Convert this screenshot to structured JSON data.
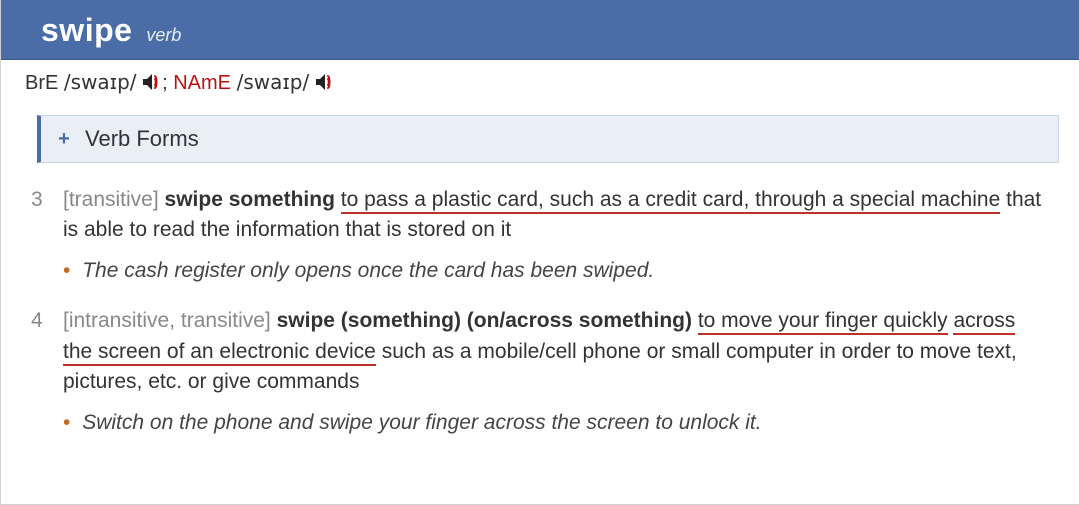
{
  "header": {
    "word": "swipe",
    "pos": "verb"
  },
  "pron": {
    "bre_label": "BrE",
    "bre_ipa": "/swaɪp/",
    "separator": "; ",
    "name_label": "NAmE",
    "name_ipa": "/swaɪp/"
  },
  "verbforms": {
    "plus": "+",
    "label": "Verb Forms"
  },
  "senses": [
    {
      "num": "3",
      "grammar": "[transitive]",
      "bold": "swipe something",
      "def_u1": "to pass a plastic card, such as a credit card, through a special machine",
      "def_rest": " that is able to read the information that is stored on it",
      "example": "The cash register only opens once the card has been swiped."
    },
    {
      "num": "4",
      "grammar": "[intransitive, transitive]",
      "bold": "swipe (something) (on/across something)",
      "def_u1": "to move your finger quickly",
      "def_u2": "across the screen of an electronic device",
      "def_rest": " such as a mobile/cell phone or small computer in order to move text, pictures, etc. or give commands",
      "example": "Switch on the phone and swipe your finger across the screen to unlock it."
    }
  ]
}
